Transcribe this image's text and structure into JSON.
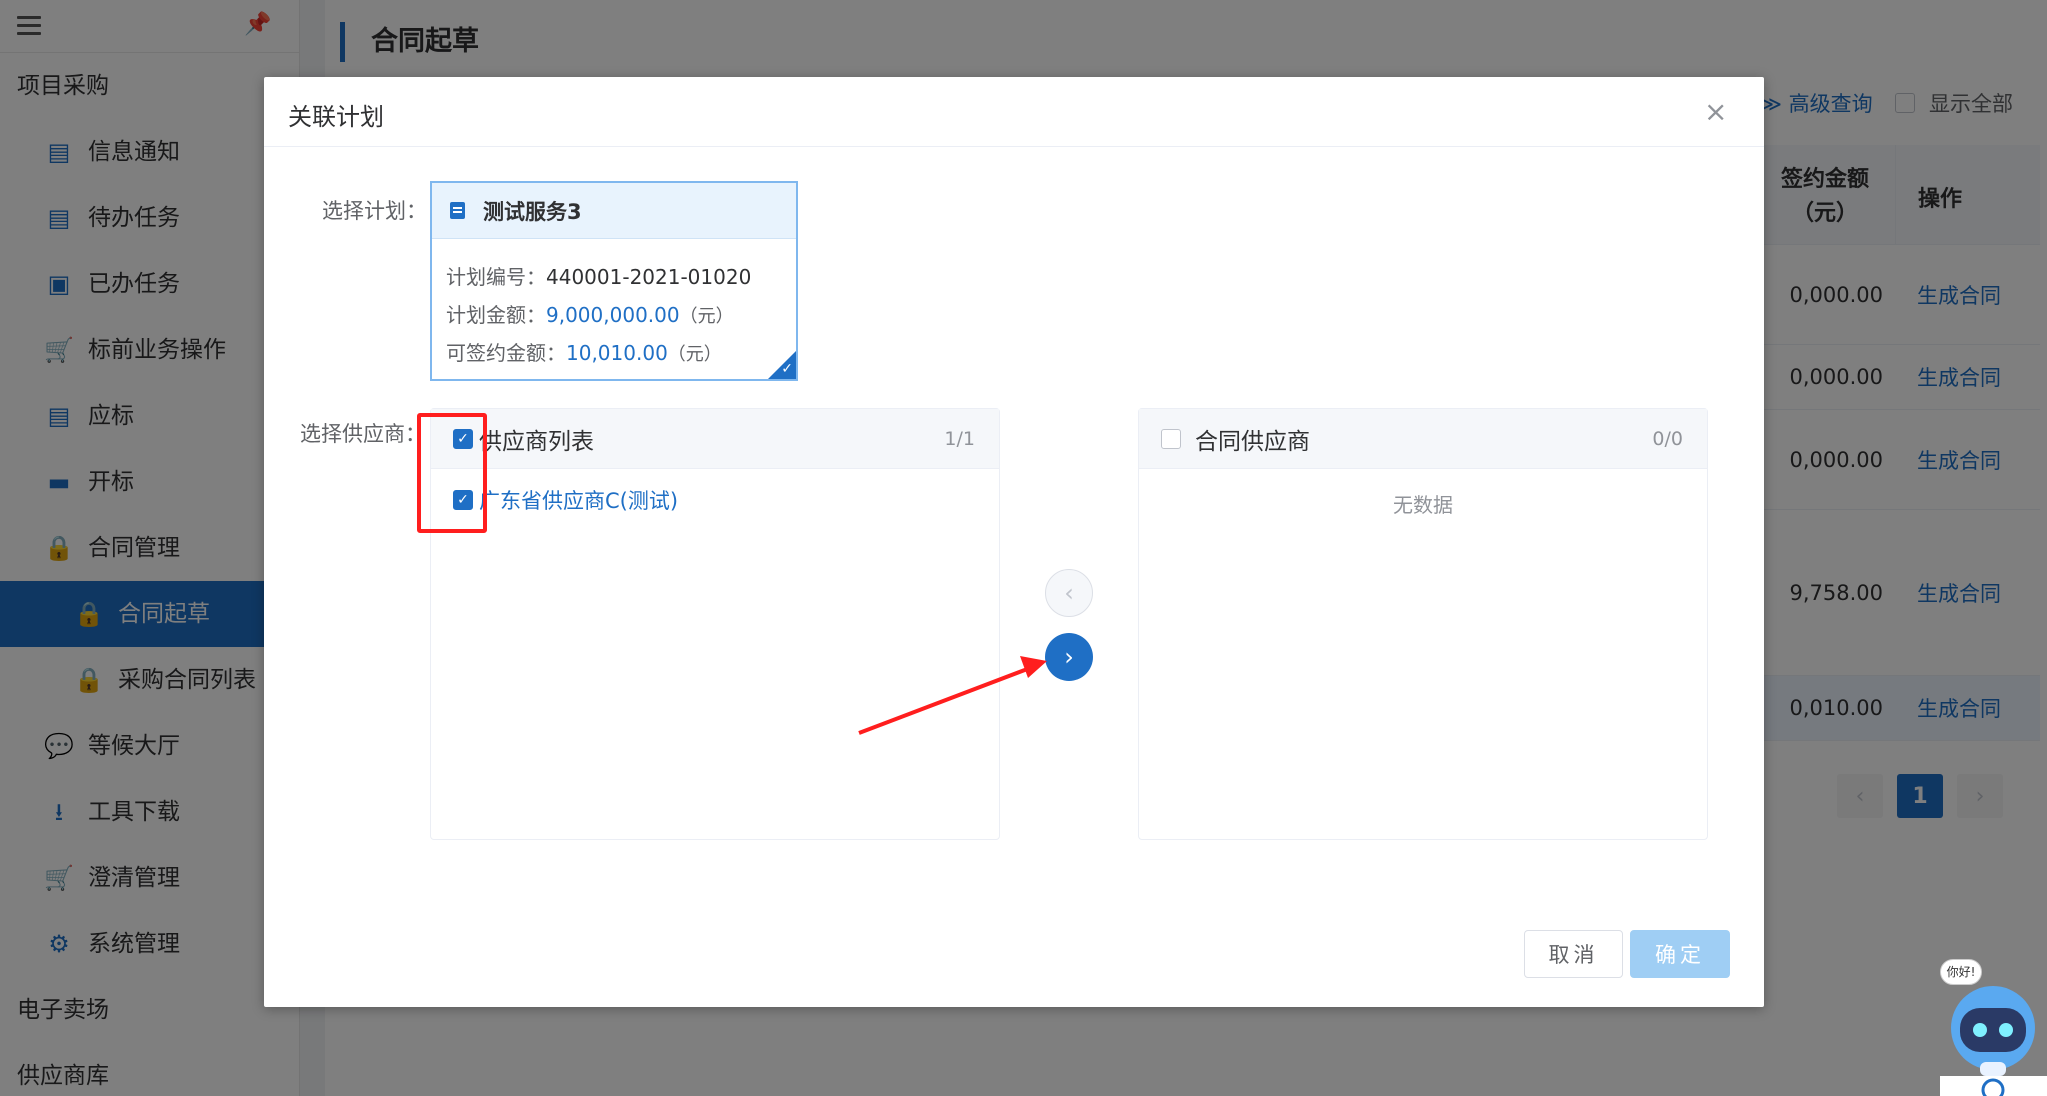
{
  "sidebar": {
    "groups": {
      "procurement": "项目采购",
      "emall": "电子卖场",
      "supplier_lib": "供应商库"
    },
    "items": [
      {
        "label": "信息通知",
        "icon": "calendar-icon"
      },
      {
        "label": "待办任务",
        "icon": "calendar-icon"
      },
      {
        "label": "已办任务",
        "icon": "calendar-check-icon"
      },
      {
        "label": "标前业务操作",
        "icon": "cart-icon"
      },
      {
        "label": "应标",
        "icon": "calendar-icon"
      },
      {
        "label": "开标",
        "icon": "document-icon"
      },
      {
        "label": "合同管理",
        "icon": "lock-icon"
      },
      {
        "label": "合同起草",
        "icon": "lock-icon"
      },
      {
        "label": "采购合同列表",
        "icon": "lock-icon"
      },
      {
        "label": "等候大厅",
        "icon": "chat-icon"
      },
      {
        "label": "工具下载",
        "icon": "download-icon"
      },
      {
        "label": "澄清管理",
        "icon": "cart-icon"
      },
      {
        "label": "系统管理",
        "icon": "gear-icon"
      }
    ]
  },
  "main": {
    "title": "合同起草",
    "advanced_query": "高级查询",
    "show_all": "显示全部",
    "table": {
      "col_amount": "签约金额（元）",
      "col_amount_l1": "签约金额",
      "col_amount_l2": "（元）",
      "col_action": "操作",
      "rows": [
        {
          "amount": "0,000.00",
          "action": "生成合同"
        },
        {
          "amount": "0,000.00",
          "action": "生成合同"
        },
        {
          "amount": "0,000.00",
          "action": "生成合同"
        },
        {
          "amount": "9,758.00",
          "action": "生成合同"
        },
        {
          "amount": "0,010.00",
          "action": "生成合同"
        }
      ]
    },
    "pager": {
      "prev": "‹",
      "current": "1",
      "next": "›"
    }
  },
  "dialog": {
    "title": "关联计划",
    "close": "×",
    "select_plan_label": "选择计划：",
    "select_supplier_label": "选择供应商：",
    "plan": {
      "name": "测试服务3",
      "code_label": "计划编号：",
      "code": "440001-2021-01020",
      "amount_label": "计划金额：",
      "amount": "9,000,000.00",
      "amount_unit": "（元）",
      "signable_label": "可签约金额：",
      "signable": "10,010.00",
      "signable_unit": "（元）"
    },
    "source_panel": {
      "title": "供应商列表",
      "count": "1/1",
      "items": [
        {
          "label": "广东省供应商C(测试)",
          "checked": true
        }
      ]
    },
    "target_panel": {
      "title": "合同供应商",
      "count": "0/0",
      "empty": "无数据"
    },
    "cancel": "取消",
    "confirm": "确定"
  },
  "assistant": {
    "greeting": "你好!"
  },
  "colors": {
    "primary": "#1f6fc5",
    "annotation": "#ff1e1e",
    "confirm_disabled": "#9fcef4"
  }
}
